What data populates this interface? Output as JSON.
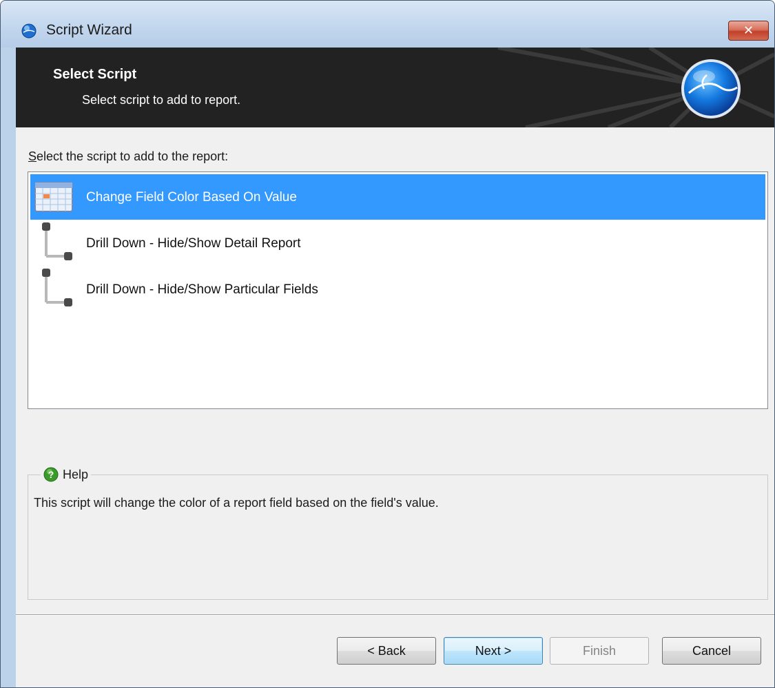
{
  "window": {
    "title": "Script Wizard",
    "close_label": "✕"
  },
  "header": {
    "title": "Select Script",
    "subtitle": "Select script to add to report."
  },
  "main": {
    "prompt_accel": "S",
    "prompt_rest": "elect the script to add to the report:",
    "scripts": [
      {
        "label": "Change Field Color Based On Value",
        "icon": "color-grid-icon",
        "selected": true
      },
      {
        "label": "Drill Down - Hide/Show Detail Report",
        "icon": "drilldown-tree-icon",
        "selected": false
      },
      {
        "label": "Drill Down - Hide/Show Particular Fields",
        "icon": "drilldown-tree-icon",
        "selected": false
      }
    ],
    "help": {
      "title": "Help",
      "text": "This script will change the color of a report field based on the field's value."
    }
  },
  "buttons": {
    "back": "< Back",
    "next": "Next >",
    "finish": "Finish",
    "cancel": "Cancel"
  },
  "colors": {
    "selection": "#3399ff",
    "banner": "#222222",
    "close": "#c2402a"
  }
}
